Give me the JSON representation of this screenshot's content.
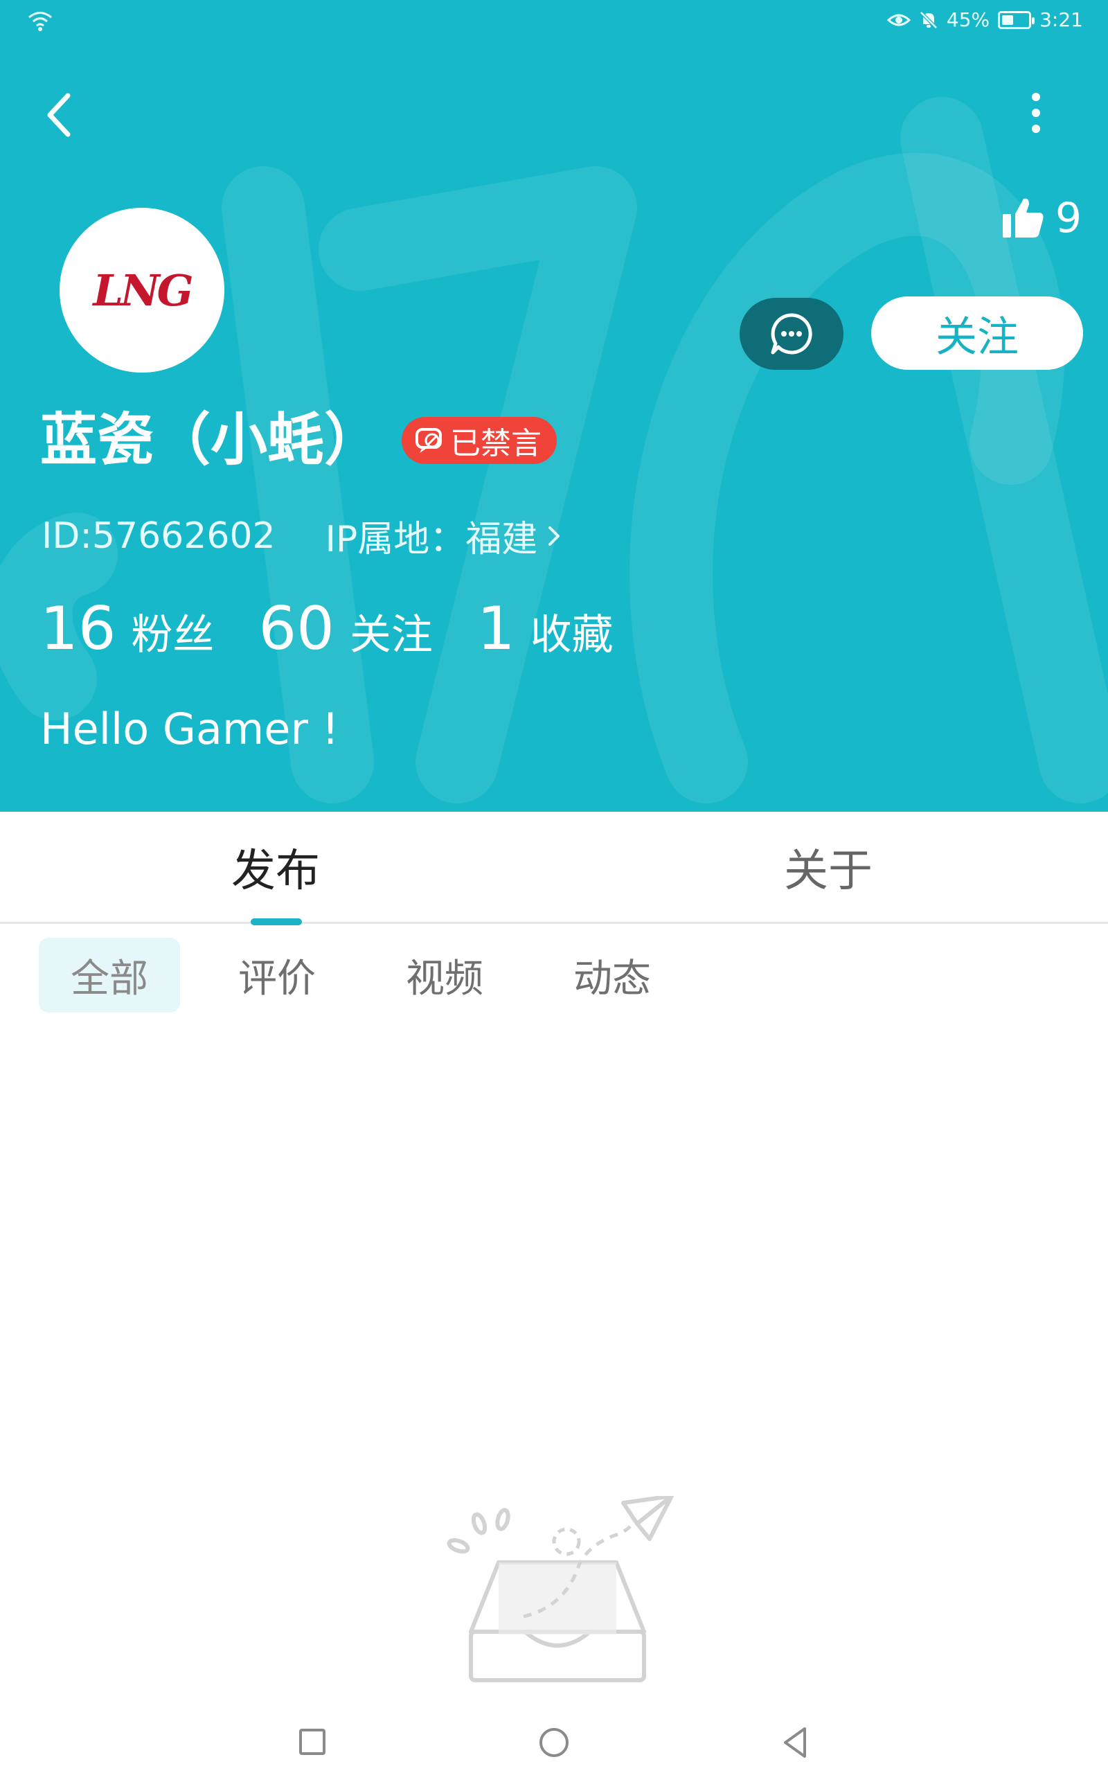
{
  "status_bar": {
    "battery": "45%",
    "time": "3:21",
    "battery_level": 0.45
  },
  "profile": {
    "likes": "9",
    "avatar_logo": "LNG",
    "name": "蓝瓷（小蚝）",
    "banned_badge": "已禁言",
    "id": "ID:57662602",
    "ip_location": "IP属地：福建",
    "follow_label": "关注",
    "stats": [
      {
        "number": "16",
        "label": "粉丝"
      },
      {
        "number": "60",
        "label": "关注"
      },
      {
        "number": "1",
        "label": "收藏"
      }
    ],
    "bio": "Hello Gamer !"
  },
  "tabs": [
    {
      "label": "发布"
    },
    {
      "label": "关于"
    }
  ],
  "filters": [
    {
      "label": "全部"
    },
    {
      "label": "评价"
    },
    {
      "label": "视频"
    },
    {
      "label": "动态"
    }
  ],
  "colors": {
    "header_bg": "#16b8c9",
    "accent": "#1bb4c6",
    "badge_red": "#f0433a",
    "message_button": "#0f6d78"
  },
  "icons": {
    "back": "chevron-left-icon",
    "more": "more-vertical-icon",
    "like": "thumbs-up-icon",
    "message": "chat-bubble-icon",
    "banned": "muted-chat-icon",
    "empty": "empty-inbox-icon"
  }
}
